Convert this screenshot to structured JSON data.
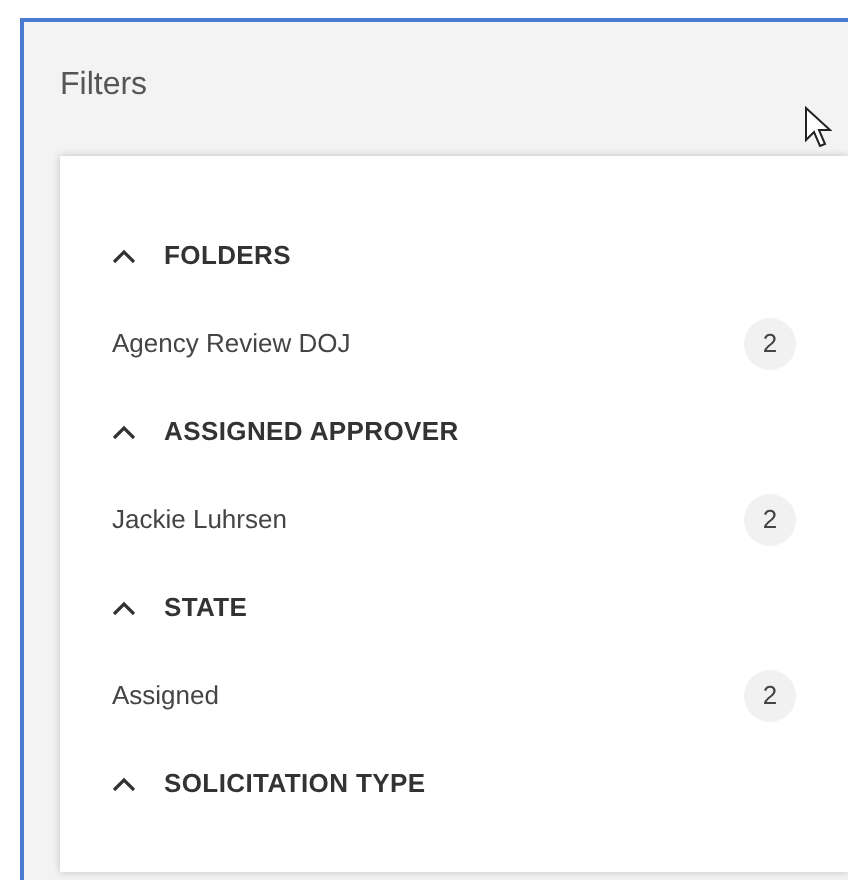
{
  "panel": {
    "title": "Filters"
  },
  "sections": [
    {
      "title": "FOLDERS",
      "expanded": true,
      "items": [
        {
          "label": "Agency Review DOJ",
          "count": "2"
        }
      ]
    },
    {
      "title": "ASSIGNED APPROVER",
      "expanded": true,
      "items": [
        {
          "label": "Jackie Luhrsen",
          "count": "2"
        }
      ]
    },
    {
      "title": "STATE",
      "expanded": true,
      "items": [
        {
          "label": "Assigned",
          "count": "2"
        }
      ]
    },
    {
      "title": "SOLICITATION TYPE",
      "expanded": true
    }
  ]
}
